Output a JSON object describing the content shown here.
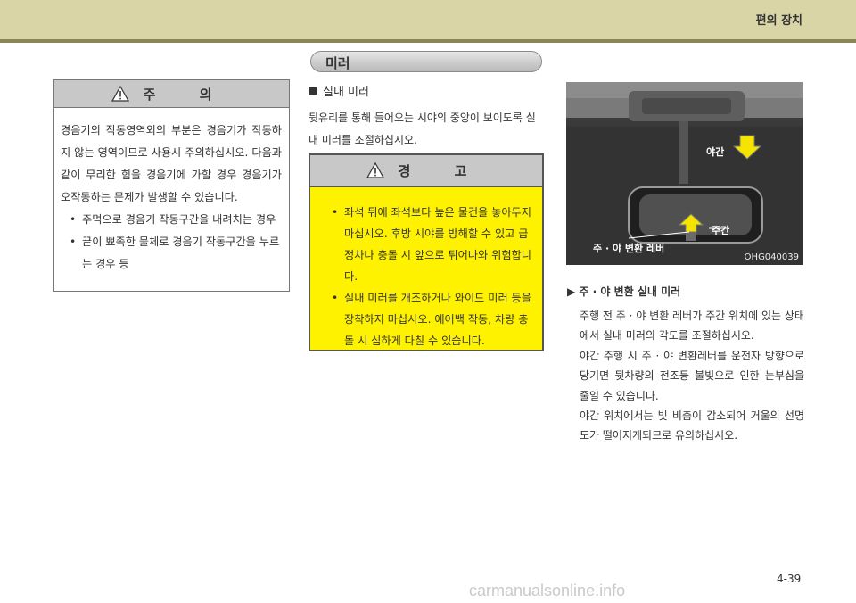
{
  "header": {
    "title": "편의 장치"
  },
  "caution": {
    "title": "주 의",
    "paragraph": "경음기의 작동영역외의 부분은 경음기가 작동하지 않는 영역이므로 사용시 주의하십시오. 다음과 같이 무리한 힘을 경음기에 가할 경우 경음기가 오작동하는 문제가 발생할 수 있습니다.",
    "bullets": [
      "주먹으로 경음기 작동구간을 내려치는 경우",
      "끝이 뾰족한 물체로 경음기 작동구간을 누르는 경우 등"
    ]
  },
  "section": {
    "title": "미러",
    "subhead": "실내 미러",
    "intro": "뒷유리를 통해 들어오는 시야의 중앙이 보이도록 실내 미러를 조절하십시오."
  },
  "warning": {
    "title": "경 고",
    "bullets": [
      "좌석 뒤에 좌석보다 높은 물건을 놓아두지 마십시오. 후방 시야를 방해할 수 있고 급정차나 충돌 시 앞으로 튀어나와 위험합니다.",
      "실내 미러를 개조하거나 와이드 미러 등을 장착하지 마십시오. 에어백 작동, 차량 충돌 시 심하게 다칠 수 있습니다."
    ]
  },
  "photo": {
    "label_night": "야간",
    "label_day": "주간",
    "label_lever": "주 · 야 변환 레버",
    "code": "OHG040039"
  },
  "right": {
    "subtitle": "▶ 주 · 야 변환 실내 미러",
    "paragraphs": [
      "주행 전 주 · 야 변환 레버가 주간 위치에 있는 상태에서 실내 미러의 각도를 조절하십시오.",
      "야간 주행 시 주 · 야 변환레버를 운전자 방향으로 당기면 뒷차량의 전조등 불빛으로 인한 눈부심을 줄일 수 있습니다.",
      "야간 위치에서는 빛 비춤이 감소되어 거울의 선명도가 떨어지게되므로 유의하십시오."
    ]
  },
  "footer": {
    "page": "4-39",
    "watermark": "carmanualsonline.info"
  }
}
